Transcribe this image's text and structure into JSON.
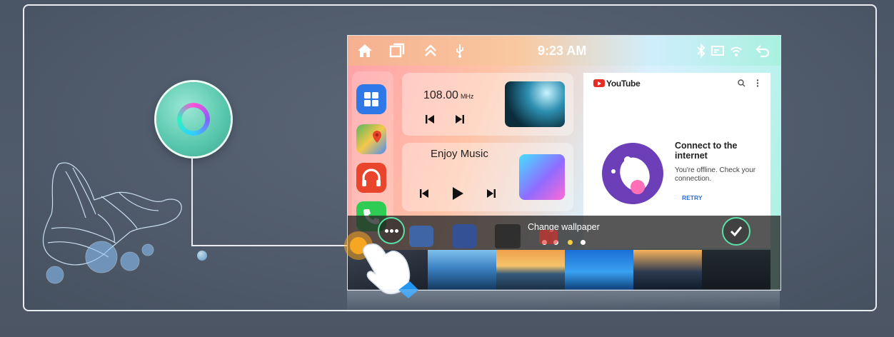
{
  "status_bar": {
    "time": "9:23 AM",
    "left_icons": [
      "home-icon",
      "recent-apps-icon",
      "chevron-up-icon",
      "usb-icon"
    ],
    "right_icons": [
      "bluetooth-icon",
      "cast-icon",
      "signal-icon",
      "back-icon"
    ]
  },
  "dock": {
    "apps": [
      {
        "icon": "apps-grid-icon",
        "color": "#2f78e8"
      },
      {
        "icon": "maps-icon",
        "color": "#3aa757"
      },
      {
        "icon": "headphones-icon",
        "color": "#e8452c"
      },
      {
        "icon": "phone-icon",
        "color": "#2ecc52"
      }
    ]
  },
  "radio": {
    "frequency": "108.00",
    "unit": "MHz"
  },
  "music": {
    "title": "Enjoy Music"
  },
  "youtube": {
    "brand": "YouTube",
    "title": "Connect to the internet",
    "description": "You're offline. Check your connection.",
    "retry_label": "RETRY"
  },
  "wallpaper_panel": {
    "title": "Change wallpaper",
    "page_dots": 4,
    "active_dot": 2,
    "accent": "#f4d03f"
  },
  "colors": {
    "accent_green": "#5be0a6",
    "frame_border": "#e9edf2"
  }
}
